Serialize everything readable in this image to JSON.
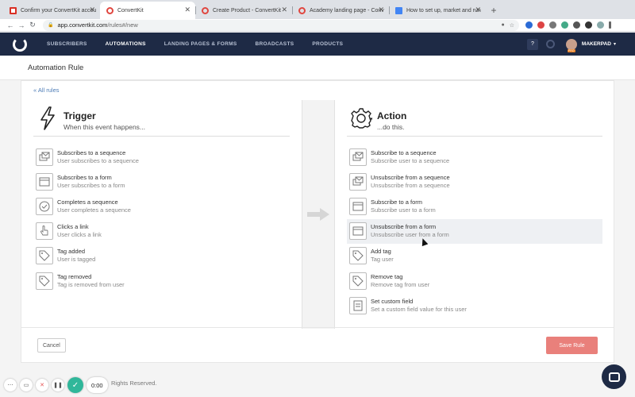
{
  "browser": {
    "tabs": [
      {
        "label": "Confirm your ConvertKit accou",
        "favicon": "gmail",
        "active": false
      },
      {
        "label": "ConvertKit",
        "favicon": "ck",
        "active": true
      },
      {
        "label": "Create Product - ConvertKit",
        "favicon": "ck",
        "active": false
      },
      {
        "label": "Academy landing page - Conv",
        "favicon": "ck",
        "active": false
      },
      {
        "label": "How to set up, market and run",
        "favicon": "doc",
        "active": false
      }
    ],
    "url_host": "app.convertkit.com",
    "url_path": "/rules#/new"
  },
  "appnav": {
    "menu": [
      "SUBSCRIBERS",
      "AUTOMATIONS",
      "LANDING PAGES & FORMS",
      "BROADCASTS",
      "PRODUCTS"
    ],
    "active_menu": "AUTOMATIONS",
    "help_label": "?",
    "user_name": "MAKERPAD",
    "colors": {
      "nav_bg": "#1e2a45",
      "accent": "#e9807b"
    }
  },
  "page": {
    "title": "Automation Rule",
    "back_link": "« All rules"
  },
  "trigger": {
    "title": "Trigger",
    "subtitle": "When this event happens...",
    "items": [
      {
        "label": "Subscribes to a sequence",
        "desc": "User subscribes to a sequence",
        "icon": "sequence-icon"
      },
      {
        "label": "Subscribes to a form",
        "desc": "User subscribes to a form",
        "icon": "form-icon"
      },
      {
        "label": "Completes a sequence",
        "desc": "User completes a sequence",
        "icon": "check-icon"
      },
      {
        "label": "Clicks a link",
        "desc": "User clicks a link",
        "icon": "pointer-icon"
      },
      {
        "label": "Tag added",
        "desc": "User is tagged",
        "icon": "tag-icon"
      },
      {
        "label": "Tag removed",
        "desc": "Tag is removed from user",
        "icon": "tag-icon"
      }
    ]
  },
  "action": {
    "title": "Action",
    "subtitle": "...do this.",
    "items": [
      {
        "label": "Subscribe to a sequence",
        "desc": "Subscribe user to a sequence",
        "icon": "sequence-icon"
      },
      {
        "label": "Unsubscribe from a sequence",
        "desc": "Unsubscribe from a sequence",
        "icon": "sequence-icon"
      },
      {
        "label": "Subscribe to a form",
        "desc": "Subscribe user to a form",
        "icon": "form-icon"
      },
      {
        "label": "Unsubscribe from a form",
        "desc": "Unsubscribe user from a form",
        "icon": "form-icon"
      },
      {
        "label": "Add tag",
        "desc": "Tag user",
        "icon": "tag-icon"
      },
      {
        "label": "Remove tag",
        "desc": "Remove tag from user",
        "icon": "tag-icon"
      },
      {
        "label": "Set custom field",
        "desc": "Set a custom field value for this user",
        "icon": "field-icon"
      }
    ]
  },
  "footer": {
    "cancel_label": "Cancel",
    "save_label": "Save Rule",
    "copyright": "Rights Reserved."
  },
  "recorder": {
    "time": "0:00"
  }
}
